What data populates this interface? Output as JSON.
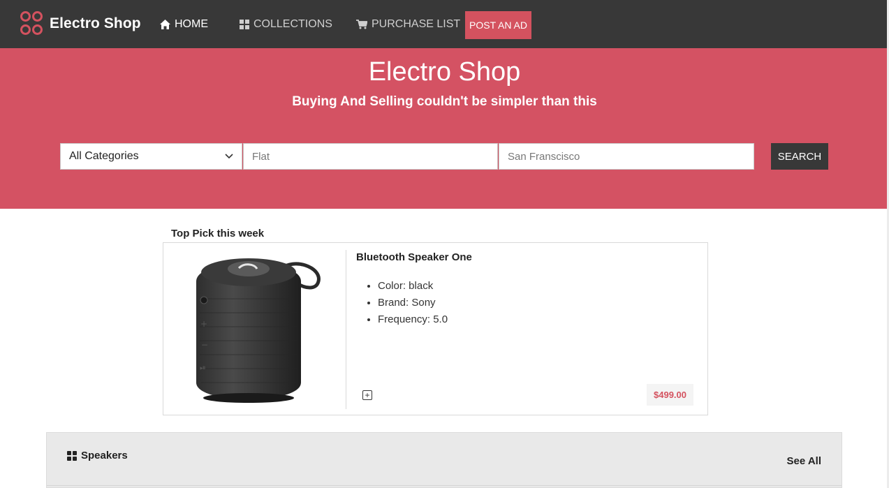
{
  "navbar": {
    "brand": "Electro Shop",
    "items": [
      {
        "label": "HOME",
        "icon": "home-icon",
        "active": true
      },
      {
        "label": "COLLECTIONS",
        "icon": "grid-icon",
        "active": false
      },
      {
        "label": "PURCHASE LIST",
        "icon": "cart-icon",
        "active": false
      }
    ],
    "post_ad_label": "POST AN AD"
  },
  "hero": {
    "title": "Electro Shop",
    "subtitle": "Buying And Selling couldn't be simpler than this"
  },
  "search": {
    "category": "All Categories",
    "query_placeholder": "Flat",
    "location_placeholder": "San Franscisco",
    "button_label": "SEARCH"
  },
  "top_pick": {
    "heading": "Top Pick this week",
    "product": {
      "name": "Bluetooth Speaker One",
      "features": [
        "Color: black",
        "Brand: Sony",
        "Frequency: 5.0"
      ],
      "price": "$499.00"
    }
  },
  "section": {
    "title": "Speakers",
    "see_all": "See All"
  },
  "colors": {
    "accent": "#d45263",
    "navbar": "#383838"
  }
}
